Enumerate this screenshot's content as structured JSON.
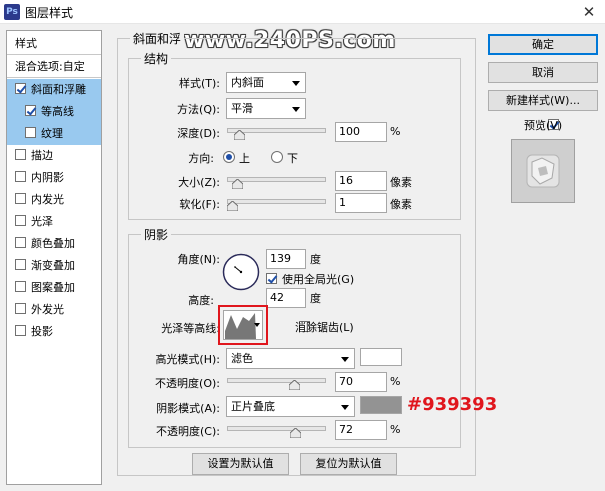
{
  "window": {
    "title": "图层样式",
    "close_glyph": "✕"
  },
  "watermark": "www.240PS.com",
  "style_list": {
    "header": "样式",
    "blend": "混合选项:自定",
    "items": [
      {
        "label": "斜面和浮雕",
        "checked": true,
        "selected": true
      },
      {
        "label": "等高线",
        "checked": true,
        "selected": true
      },
      {
        "label": "纹理",
        "checked": false,
        "selected": true
      },
      {
        "label": "描边",
        "checked": false
      },
      {
        "label": "内阴影",
        "checked": false
      },
      {
        "label": "内发光",
        "checked": false
      },
      {
        "label": "光泽",
        "checked": false
      },
      {
        "label": "颜色叠加",
        "checked": false
      },
      {
        "label": "渐变叠加",
        "checked": false
      },
      {
        "label": "图案叠加",
        "checked": false
      },
      {
        "label": "外发光",
        "checked": false
      },
      {
        "label": "投影",
        "checked": false
      }
    ]
  },
  "bevel": {
    "group_title": "斜面和浮",
    "structure_title": "结构",
    "style_label": "样式(T):",
    "style_value": "内斜面",
    "technique_label": "方法(Q):",
    "technique_value": "平滑",
    "depth_label": "深度(D):",
    "depth_value": "100",
    "depth_unit": "%",
    "depth_fraction": 0.08,
    "direction_label": "方向:",
    "dir_up": "上",
    "dir_down": "下",
    "size_label": "大小(Z):",
    "size_value": "16",
    "size_unit": "像素",
    "size_fraction": 0.06,
    "soften_label": "软化(F):",
    "soften_value": "1",
    "soften_unit": "像素",
    "soften_fraction": 0.0
  },
  "shading": {
    "title": "阴影",
    "angle_label": "角度(N):",
    "angle_value": "139",
    "angle_unit": "度",
    "global_light_label": "使用全局光(G)",
    "altitude_label": "高度:",
    "altitude_value": "42",
    "altitude_unit": "度",
    "gloss_label": "光泽等高线:",
    "antialias_label": "消除锯齿(L)",
    "highlight_label": "高光模式(H):",
    "highlight_mode": "滤色",
    "highlight_color": "#ffffff",
    "h_opacity_label": "不透明度(O):",
    "h_opacity_value": "70",
    "h_opacity_unit": "%",
    "h_opacity_fraction": 0.7,
    "shadow_label": "阴影模式(A):",
    "shadow_mode": "正片叠底",
    "shadow_color": "#939393",
    "s_opacity_label": "不透明度(C):",
    "s_opacity_value": "72",
    "s_opacity_unit": "%",
    "s_opacity_fraction": 0.72
  },
  "annotation": {
    "color_text": "#939393",
    "highlight_box_color": "#e0161d"
  },
  "buttons": {
    "ok": "确定",
    "cancel": "取消",
    "new_style": "新建样式(W)...",
    "preview": "预览(V)",
    "make_default": "设置为默认值",
    "reset_default": "复位为默认值"
  }
}
